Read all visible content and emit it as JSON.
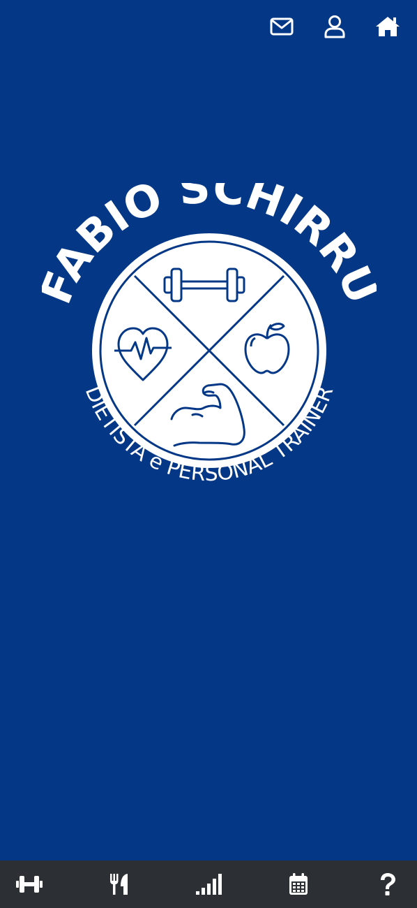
{
  "header": {
    "icons": [
      "mail-icon",
      "user-icon",
      "home-icon"
    ]
  },
  "logo": {
    "name": "FABIO SCHIRRU",
    "subtitle": "DIETISTA e PERSONAL TRAINER",
    "emblems": [
      "dumbbell-icon",
      "heartbeat-icon",
      "apple-icon",
      "flexed-arm-icon"
    ]
  },
  "bottom_nav": {
    "items": [
      "dumbbell-icon",
      "utensils-icon",
      "signal-bars-icon",
      "calendar-icon",
      "question-icon"
    ]
  },
  "colors": {
    "background": "#043887",
    "nav_background": "#2c3034",
    "foreground": "#ffffff"
  }
}
